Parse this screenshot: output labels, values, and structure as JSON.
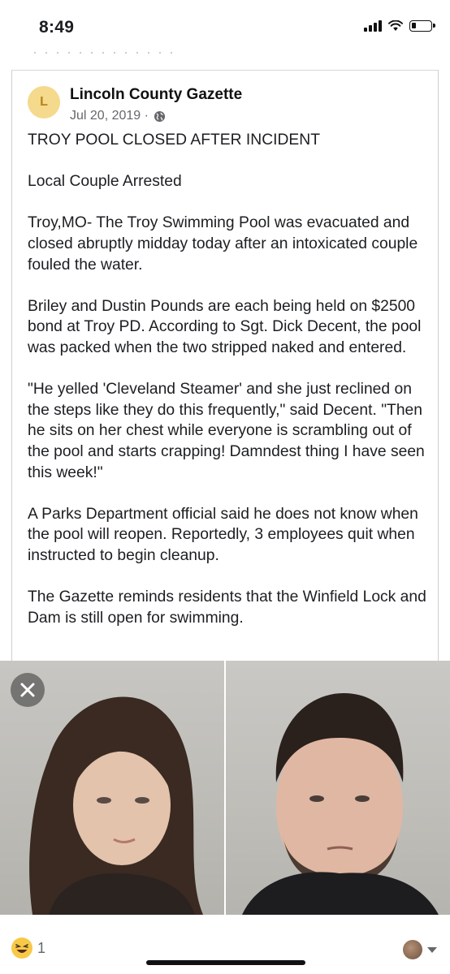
{
  "status_bar": {
    "time": "8:49"
  },
  "post": {
    "avatar_letter": "L",
    "page_name": "Lincoln County Gazette",
    "date": "Jul 20, 2019 ·",
    "paragraphs": [
      "TROY POOL CLOSED AFTER INCIDENT",
      "Local Couple Arrested",
      "Troy,MO- The Troy Swimming Pool was evacuated and closed abruptly midday today after an intoxicated couple fouled the water.",
      "Briley and Dustin Pounds are each being held on $2500 bond at Troy PD. According to Sgt. Dick Decent, the pool was packed when the two stripped naked and entered.",
      "\"He yelled 'Cleveland Steamer' and she just reclined on the steps like they do this frequently,\" said Decent. \"Then he sits on her chest while everyone is scrambling out of the pool and starts crapping! Damndest thing I have seen this week!\"",
      "A Parks Department official said he does not know when the pool will reopen. Reportedly, 3 employees quit when instructed to begin cleanup.",
      "The Gazette reminds residents that the Winfield Lock and Dam is still open for swimming."
    ]
  },
  "reactions": {
    "count": "1",
    "emoji": "laughing-emoji"
  },
  "icons": [
    "globe-icon",
    "close-icon",
    "signal-icon",
    "wifi-icon",
    "battery-icon",
    "chevron-down-icon"
  ],
  "colors": {
    "avatar_bg": "#f5d98c",
    "avatar_text": "#b38418",
    "meta_text": "#65676b"
  }
}
